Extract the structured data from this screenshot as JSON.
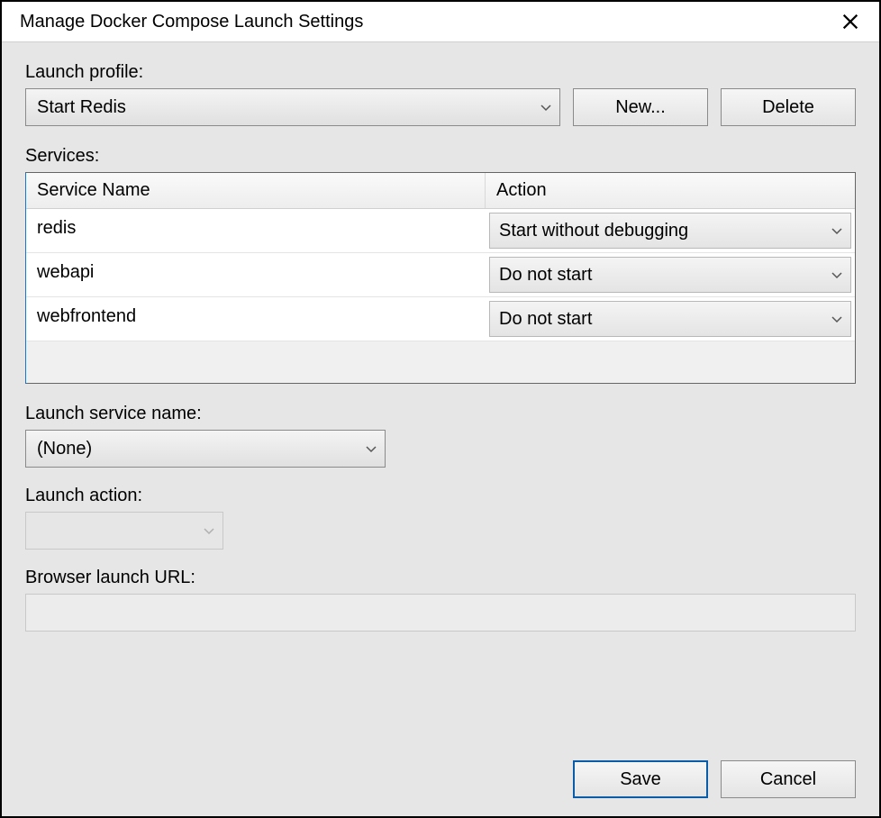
{
  "dialog": {
    "title": "Manage Docker Compose Launch Settings"
  },
  "launchProfile": {
    "label": "Launch profile:",
    "selected": "Start Redis",
    "newButton": "New...",
    "deleteButton": "Delete"
  },
  "services": {
    "label": "Services:",
    "columns": {
      "name": "Service Name",
      "action": "Action"
    },
    "rows": [
      {
        "name": "redis",
        "action": "Start without debugging"
      },
      {
        "name": "webapi",
        "action": "Do not start"
      },
      {
        "name": "webfrontend",
        "action": "Do not start"
      }
    ]
  },
  "launchServiceName": {
    "label": "Launch service name:",
    "selected": "(None)"
  },
  "launchAction": {
    "label": "Launch action:",
    "selected": ""
  },
  "browserUrl": {
    "label": "Browser launch URL:",
    "value": ""
  },
  "footer": {
    "save": "Save",
    "cancel": "Cancel"
  }
}
